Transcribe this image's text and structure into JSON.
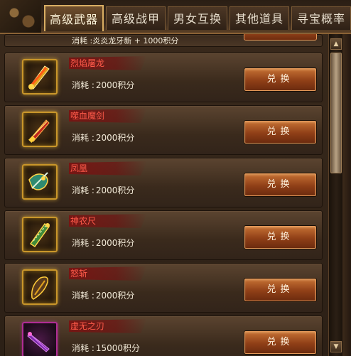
{
  "tabs": [
    {
      "label": "高级武器",
      "active": true
    },
    {
      "label": "高级战甲",
      "active": false
    },
    {
      "label": "男女互换",
      "active": false
    },
    {
      "label": "其他道具",
      "active": false
    },
    {
      "label": "寻宝概率",
      "active": false
    }
  ],
  "partial_row": {
    "cost_text": "消耗 :炎炎龙牙新 + 1000积分"
  },
  "items": [
    {
      "name": "烈焰屠龙",
      "cost_label": "消耗 :",
      "cost_value": "2000积分",
      "button": "兑换",
      "icon": "golden-sword-icon"
    },
    {
      "name": "噬血魔剑",
      "cost_label": "消耗 :",
      "cost_value": "2000积分",
      "button": "兑换",
      "icon": "red-blade-icon"
    },
    {
      "name": "凤凰",
      "cost_label": "消耗 :",
      "cost_value": "2000积分",
      "button": "兑换",
      "icon": "phoenix-sword-icon"
    },
    {
      "name": "神农尺",
      "cost_label": "消耗 :",
      "cost_value": "2000积分",
      "button": "兑换",
      "icon": "green-ruler-icon"
    },
    {
      "name": "怒斩",
      "cost_label": "消耗 :",
      "cost_value": "2000积分",
      "button": "兑换",
      "icon": "dark-blade-icon"
    },
    {
      "name": "虚无之刃",
      "cost_label": "消耗 :",
      "cost_value": "15000积分",
      "button": "兑换",
      "icon": "purple-blade-icon"
    }
  ],
  "colors": {
    "item_name": "#ff5a4a",
    "button": "#8f3f17",
    "tab_active_border": "#d9ae63"
  }
}
